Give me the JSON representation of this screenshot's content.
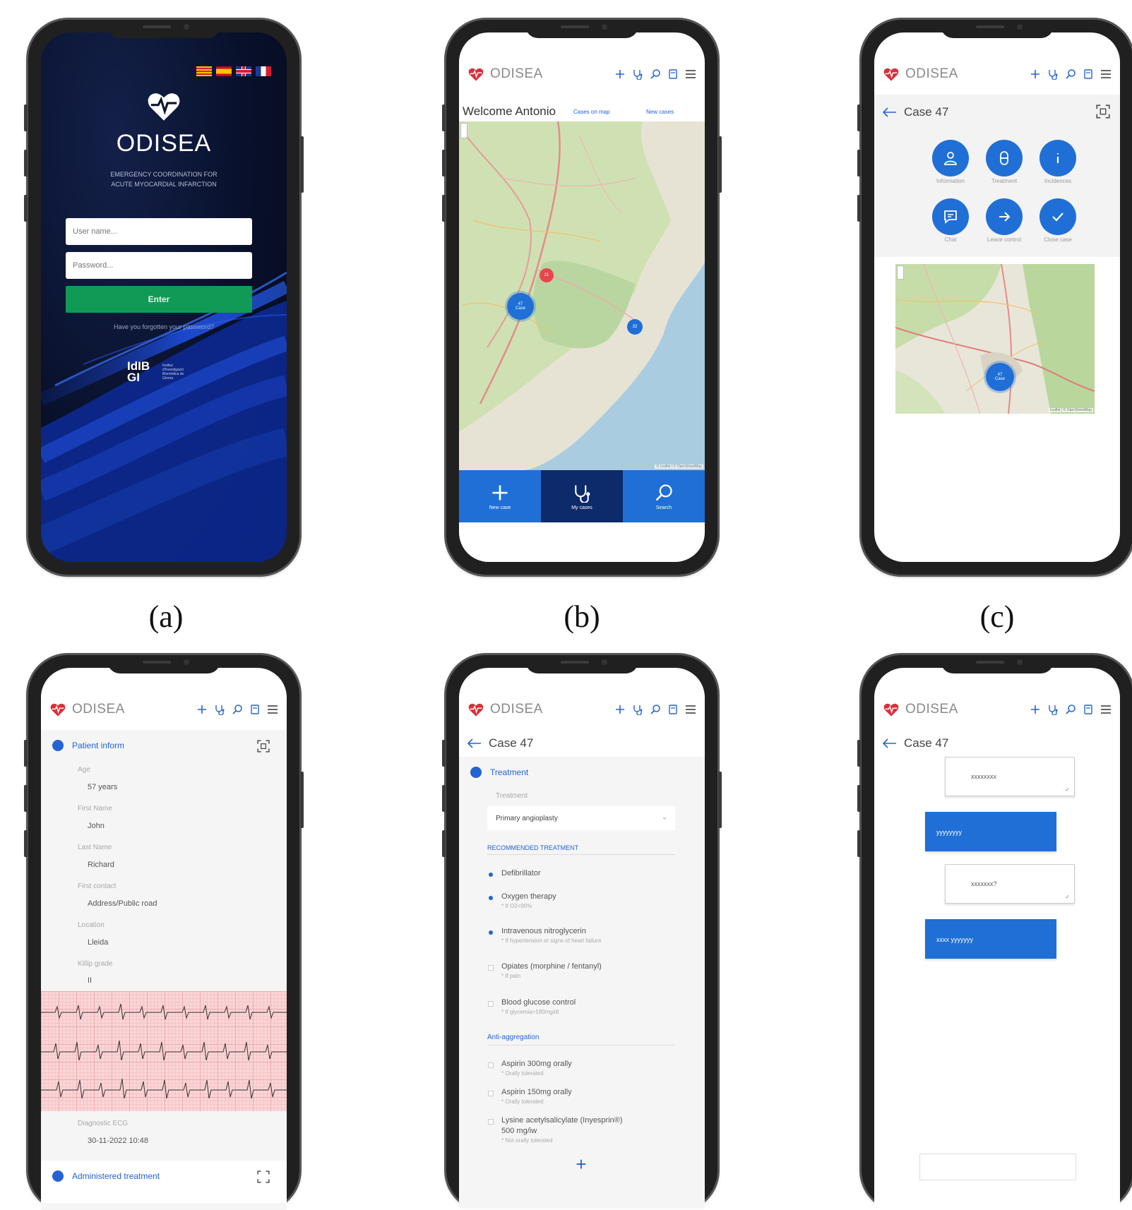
{
  "app": {
    "brand": "ODISEA"
  },
  "labels": {
    "a": "(a)",
    "b": "(b)",
    "c": "(c)"
  },
  "login": {
    "brand": "ODISEA",
    "subtitle_line1": "EMERGENCY COORDINATION FOR",
    "subtitle_line2": "ACUTE MYOCARDIAL INFARCTION",
    "username_placeholder": "User name...",
    "password_placeholder": "Password...",
    "enter_label": "Enter",
    "forgot_label": "Have you forgotten your password?",
    "sponsor_logo_text": "IdIB GI",
    "sponsor_small_text": "Institut d'Investigació Biomèdica de Girona",
    "flags": [
      "ca",
      "es",
      "uk",
      "fr"
    ]
  },
  "map_screen": {
    "welcome": "Welcome Antonio",
    "link_map": "Cases on map",
    "link_new": "New cases",
    "markers": [
      {
        "label": "21"
      },
      {
        "label": "47 Case"
      },
      {
        "label": "32"
      }
    ],
    "attribution": "© Leaflet | © OpenStreetMap",
    "nav": [
      {
        "label": "New case",
        "icon": "plus-icon"
      },
      {
        "label": "My cases",
        "icon": "stethoscope-icon"
      },
      {
        "label": "Search",
        "icon": "search-icon"
      }
    ]
  },
  "case_screen": {
    "title": "Case 47",
    "actions": [
      {
        "label": "Information",
        "icon": "user-icon"
      },
      {
        "label": "Treatment",
        "icon": "pill-icon"
      },
      {
        "label": "Incidences",
        "icon": "info-icon"
      },
      {
        "label": "Chat",
        "icon": "chat-icon"
      },
      {
        "label": "Leave control",
        "icon": "arrow-right-icon"
      },
      {
        "label": "Close case",
        "icon": "check-icon"
      }
    ],
    "marker_label": "47 Case",
    "attribution": "Leaflet | © OpenStreetMap"
  },
  "patient_screen": {
    "section_title": "Patient inform",
    "fields": [
      {
        "label": "Age",
        "value": "57 years"
      },
      {
        "label": "First Name",
        "value": "John"
      },
      {
        "label": "Last Name",
        "value": "Richard"
      },
      {
        "label": "First contact",
        "value": "Address/Public road"
      },
      {
        "label": "Location",
        "value": "Lleida"
      },
      {
        "label": "Killip grade",
        "value": "II"
      }
    ],
    "ecg_label": "Diagnostic ECG",
    "ecg_value": "30-11-2022 10:48",
    "next_section": "Administered treatment"
  },
  "treatment_screen": {
    "title": "Case 47",
    "section_title": "Treatment",
    "field_label": "Treatment",
    "selected": "Primary angioplasty",
    "recommended_header": "RECOMMENDED TREATMENT",
    "items": [
      {
        "label": "Defibrillator",
        "sub": "",
        "checked": true
      },
      {
        "label": "Oxygen therapy",
        "sub": "* If O2<90%",
        "checked": true
      },
      {
        "label": "Intravenous nitroglycerin",
        "sub": "* If hypertension or signs of heart failure",
        "checked": true
      },
      {
        "label": "Opiates (morphine / fentanyl)",
        "sub": "* If pain",
        "checked": false
      },
      {
        "label": "Blood glucose control",
        "sub": "* If glycemia>180mg/dl",
        "checked": false
      }
    ],
    "anti_header": "Anti-aggregation",
    "anti_items": [
      {
        "label": "Aspirin 300mg orally",
        "sub": "* Orally tolerated",
        "checked": false
      },
      {
        "label": "Aspirin 150mg orally",
        "sub": "* Orally tolerated",
        "checked": false
      },
      {
        "label": "Lysine acetylsalicylate (Inyesprin®)",
        "label2": "500 mg/iw",
        "sub": "* Not orally tolerated",
        "checked": false
      }
    ],
    "add_label": "+"
  },
  "chat_screen": {
    "title": "Case 47",
    "messages": [
      {
        "text": "xxxxxxxx",
        "side": "received"
      },
      {
        "text": "yyyyyyyy",
        "side": "sent"
      },
      {
        "text": "xxxxxxx?",
        "side": "received"
      },
      {
        "text": "xxxx yyyyyyy",
        "side": "sent"
      }
    ],
    "input_placeholder": ""
  },
  "colors": {
    "accent": "#2463d3",
    "brand_red": "#d9303a",
    "enter_green": "#109a55",
    "login_bg": "#0b1430"
  }
}
